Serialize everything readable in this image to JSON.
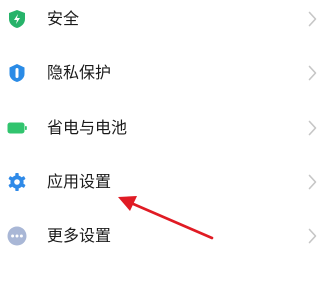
{
  "settings": {
    "items": [
      {
        "label": "安全",
        "icon": "shield-bolt-icon",
        "color": "#27b36a"
      },
      {
        "label": "隐私保护",
        "icon": "privacy-shield-icon",
        "color": "#2a8be6"
      },
      {
        "label": "省电与电池",
        "icon": "battery-icon",
        "color": "#31c46e"
      },
      {
        "label": "应用设置",
        "icon": "gear-icon",
        "color": "#2f8ae8"
      },
      {
        "label": "更多设置",
        "icon": "more-dots-icon",
        "color": "#8a9cc4"
      }
    ]
  },
  "annotation": {
    "arrow_color": "#e01b24",
    "target": "应用设置"
  }
}
